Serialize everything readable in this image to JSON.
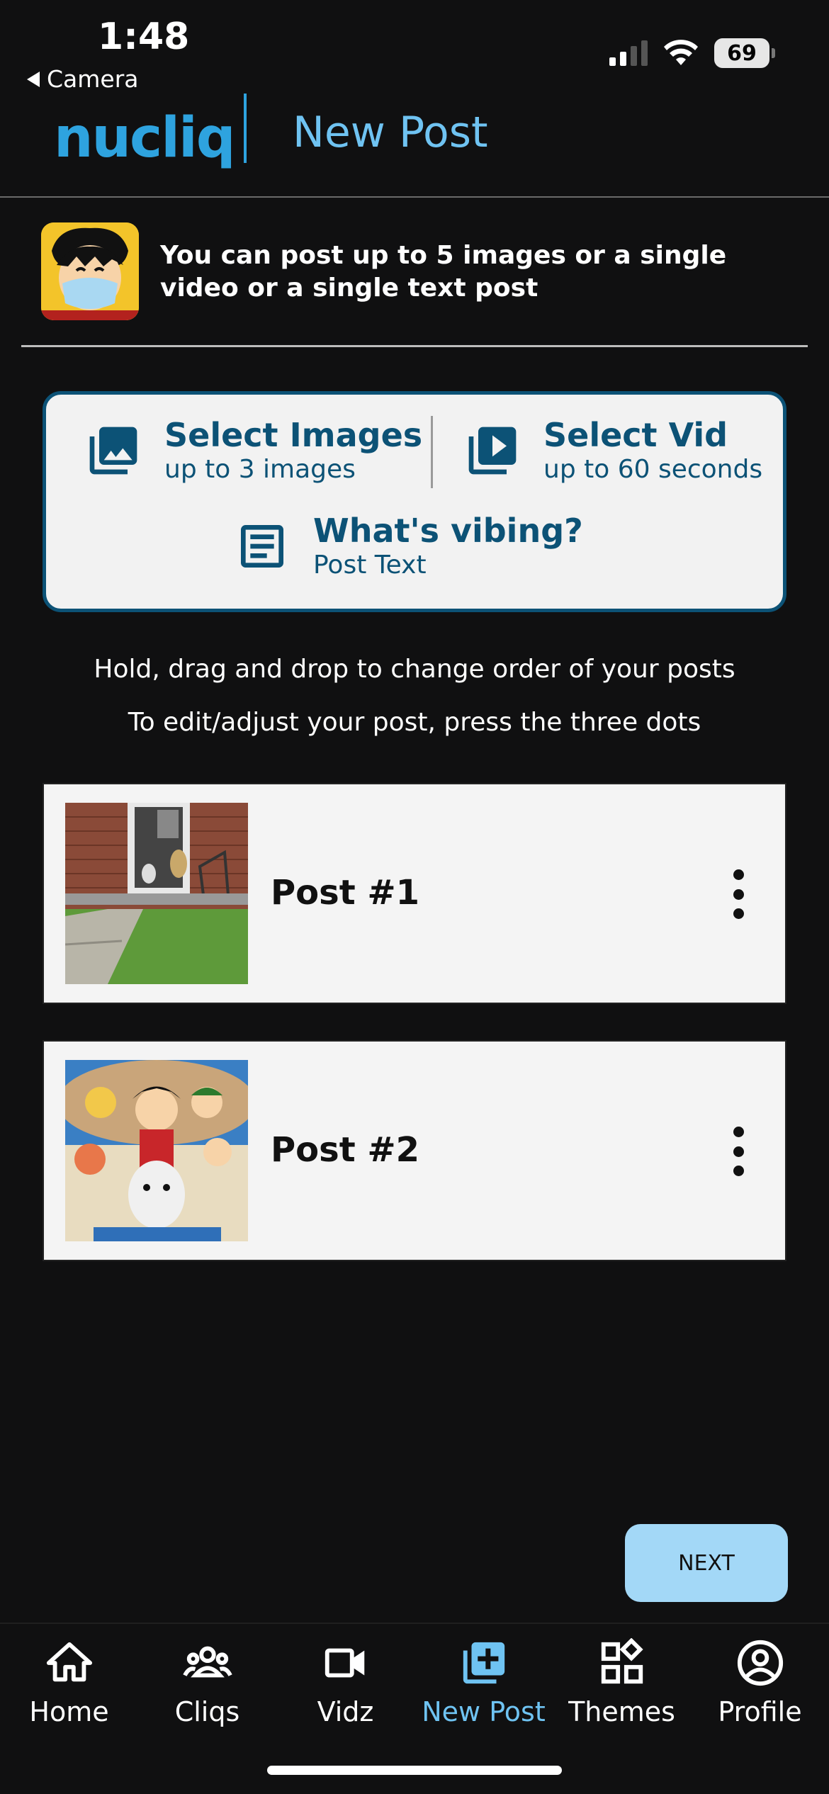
{
  "status": {
    "time": "1:48",
    "back_label": "Camera",
    "battery": "69"
  },
  "header": {
    "logo": "nucliq",
    "title": "New Post"
  },
  "info": {
    "text": "You can post up to 5 images or a single video or a single text post"
  },
  "select_options": {
    "images": {
      "title": "Select Images",
      "sub": "up to 3 images",
      "icon": "image-icon"
    },
    "video": {
      "title": "Select Vid",
      "sub": "up to 60 seconds",
      "icon": "play-video-icon"
    },
    "text": {
      "title": "What's vibing?",
      "sub": "Post Text",
      "icon": "document-icon"
    }
  },
  "hints": {
    "line1": "Hold, drag and drop to change order of your posts",
    "line2": "To edit/adjust your post, press the three dots"
  },
  "posts": [
    {
      "label": "Post #1"
    },
    {
      "label": "Post #2"
    }
  ],
  "next_label": "NEXT",
  "nav": {
    "items": [
      {
        "label": "Home",
        "icon": "home-icon"
      },
      {
        "label": "Cliqs",
        "icon": "group-icon"
      },
      {
        "label": "Vidz",
        "icon": "video-camera-icon"
      },
      {
        "label": "New Post",
        "icon": "add-post-icon"
      },
      {
        "label": "Themes",
        "icon": "themes-icon"
      },
      {
        "label": "Profile",
        "icon": "profile-icon"
      }
    ],
    "active": "New Post"
  },
  "colors": {
    "accent": "#2ea3df",
    "accent_light": "#6fc3f2",
    "card_border": "#0c5276",
    "next_button": "#a3d8f7",
    "background": "#101011"
  }
}
